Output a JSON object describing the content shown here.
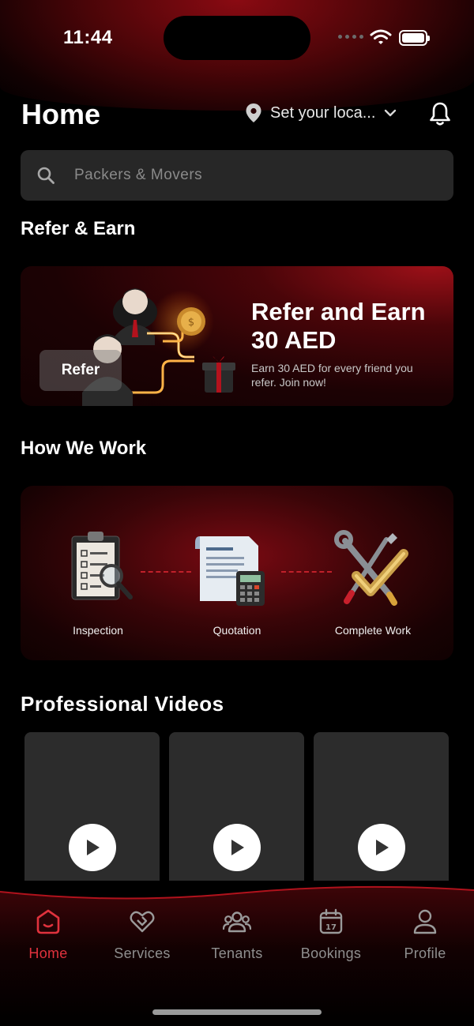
{
  "status_bar": {
    "time": "11:44"
  },
  "header": {
    "title": "Home",
    "location_label": "Set your loca...",
    "location_icon": "location-pin-icon",
    "bell_icon": "bell-icon"
  },
  "search": {
    "placeholder": "Packers & Movers",
    "icon": "search-icon"
  },
  "refer_section": {
    "title": "Refer & Earn",
    "button_label": "Refer",
    "headline": "Refer and Earn 30 AED",
    "subtext": "Earn 30 AED for every friend you refer. Join now!"
  },
  "how_we_work": {
    "title": "How We Work",
    "steps": [
      {
        "label": "Inspection",
        "icon": "clipboard-magnifier-icon"
      },
      {
        "label": "Quotation",
        "icon": "receipt-calculator-icon"
      },
      {
        "label": "Complete Work",
        "icon": "tools-check-icon"
      }
    ]
  },
  "videos": {
    "title": "Professional Videos",
    "items": [
      {
        "icon": "play-icon"
      },
      {
        "icon": "play-icon"
      },
      {
        "icon": "play-icon"
      }
    ]
  },
  "tabbar": {
    "items": [
      {
        "label": "Home",
        "icon": "home-icon",
        "active": true
      },
      {
        "label": "Services",
        "icon": "handshake-icon",
        "active": false
      },
      {
        "label": "Tenants",
        "icon": "users-icon",
        "active": false
      },
      {
        "label": "Bookings",
        "icon": "calendar-icon",
        "active": false,
        "icon_text": "17"
      },
      {
        "label": "Profile",
        "icon": "person-icon",
        "active": false
      }
    ]
  },
  "colors": {
    "accent": "#e0323d",
    "background": "#000000",
    "card": "#272727"
  }
}
